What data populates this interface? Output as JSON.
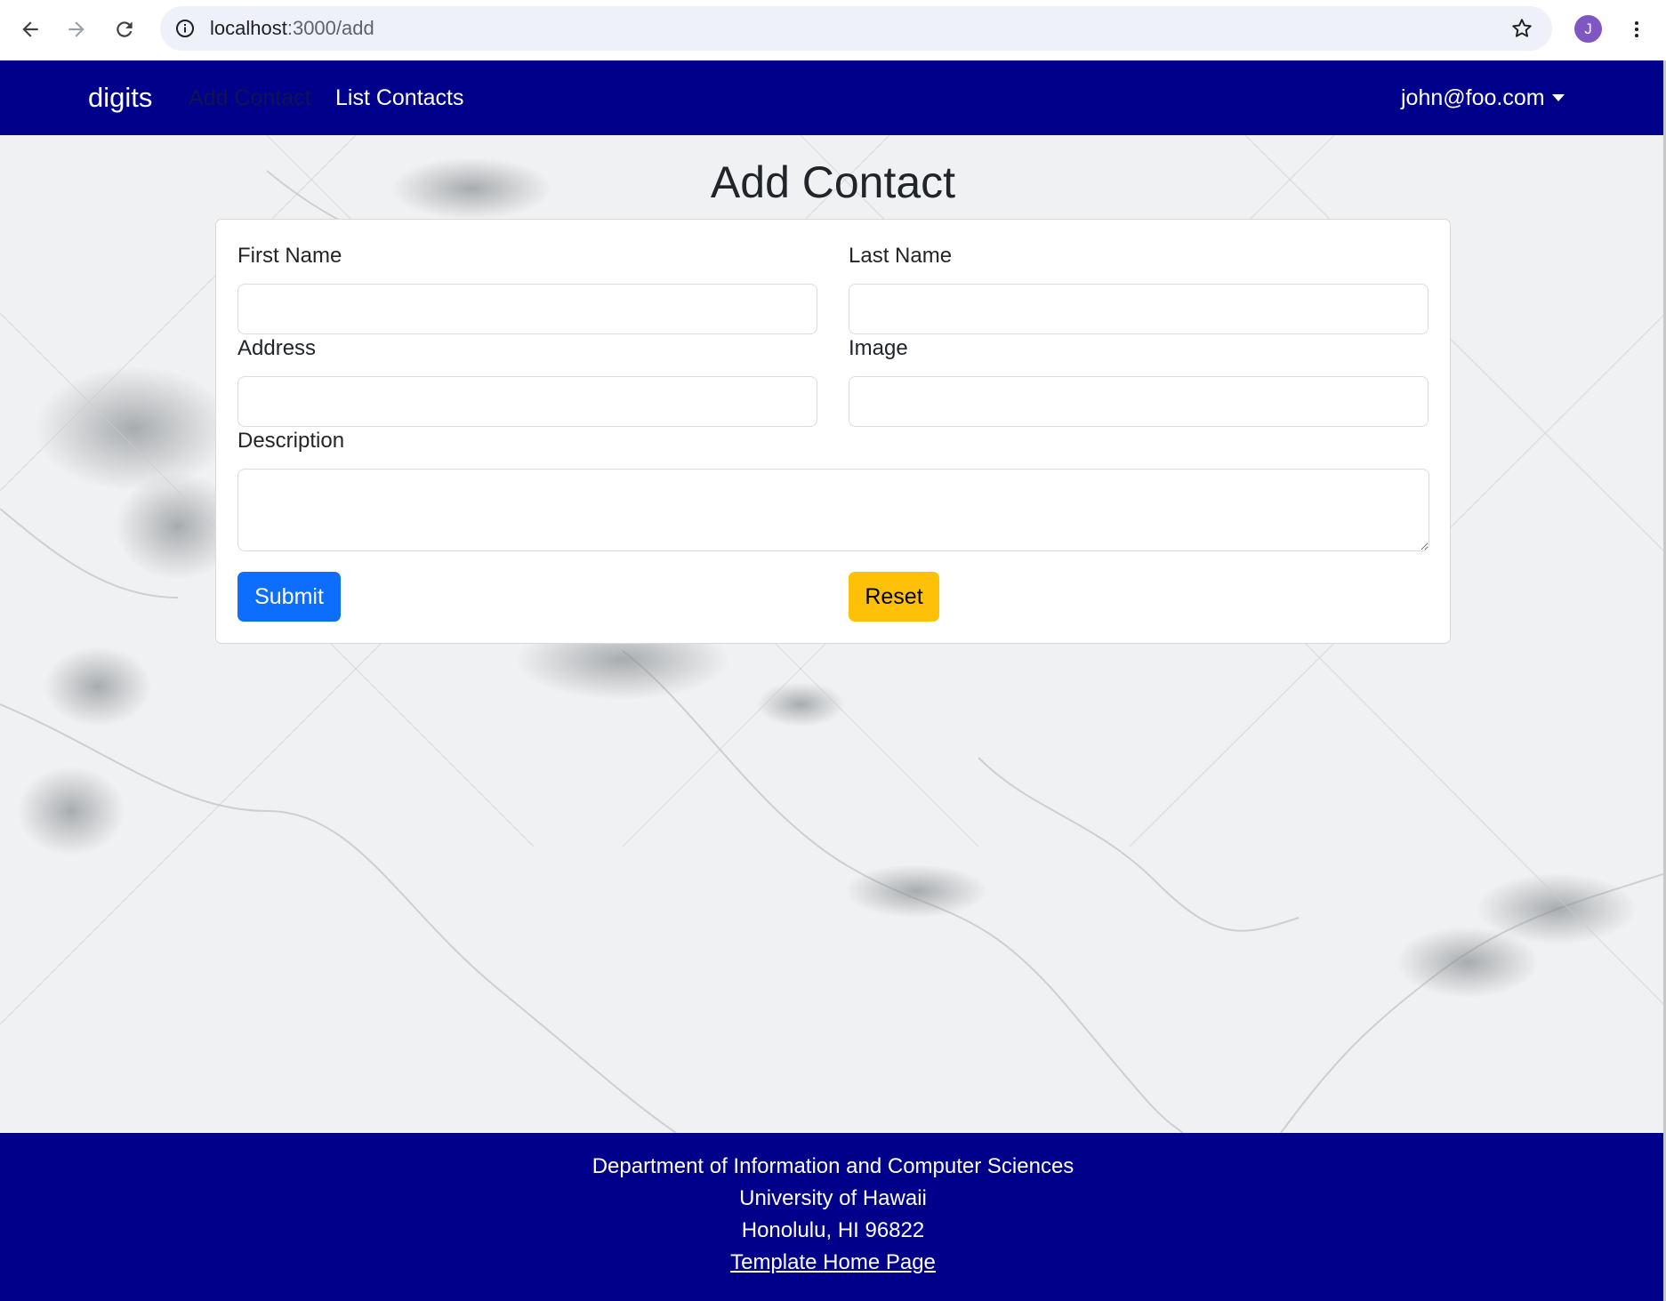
{
  "browser": {
    "url_host": "localhost",
    "url_path": ":3000/add",
    "profile_initial": "J",
    "icons": {
      "back": "arrow-left-icon",
      "forward": "arrow-right-icon",
      "reload": "reload-icon",
      "site_info": "info-icon",
      "bookmark": "star-icon",
      "menu": "kebab-menu-icon"
    }
  },
  "navbar": {
    "brand": "digits",
    "links": [
      {
        "label": "Add Contact",
        "active": true
      },
      {
        "label": "List Contacts",
        "active": false
      }
    ],
    "user": "john@foo.com"
  },
  "form": {
    "title": "Add Contact",
    "fields": {
      "first_name": {
        "label": "First Name",
        "value": ""
      },
      "last_name": {
        "label": "Last Name",
        "value": ""
      },
      "address": {
        "label": "Address",
        "value": ""
      },
      "image": {
        "label": "Image",
        "value": ""
      },
      "description": {
        "label": "Description",
        "value": ""
      }
    },
    "submit_label": "Submit",
    "reset_label": "Reset"
  },
  "footer": {
    "line1": "Department of Information and Computer Sciences",
    "line2": "University of Hawaii",
    "line3": "Honolulu, HI 96822",
    "link": "Template Home Page"
  },
  "colors": {
    "navbar_bg": "#00008b",
    "submit_bg": "#0d6efd",
    "reset_bg": "#ffc107",
    "active_link": "#12124f"
  }
}
